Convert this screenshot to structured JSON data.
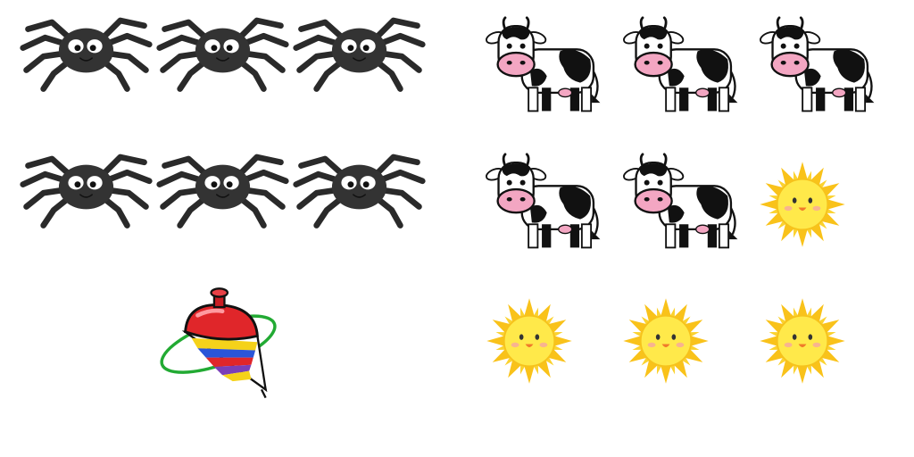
{
  "left_group": {
    "items": [
      "spider-icon",
      "spider-icon",
      "spider-icon",
      "spider-icon",
      "spider-icon",
      "spider-icon",
      "spinning-top-icon"
    ]
  },
  "right_group": {
    "items": [
      "cow-icon",
      "cow-icon",
      "cow-icon",
      "cow-icon",
      "cow-icon",
      "sun-icon",
      "sun-icon",
      "sun-icon",
      "sun-icon"
    ]
  },
  "colors": {
    "spider_body": "#333333",
    "cow_spots": "#111111",
    "cow_muzzle": "#f3a6c2",
    "sun_core": "#ffe94a",
    "sun_rays": "#f9c21a",
    "top_red": "#e0262a",
    "top_ring": "#22aa33"
  }
}
